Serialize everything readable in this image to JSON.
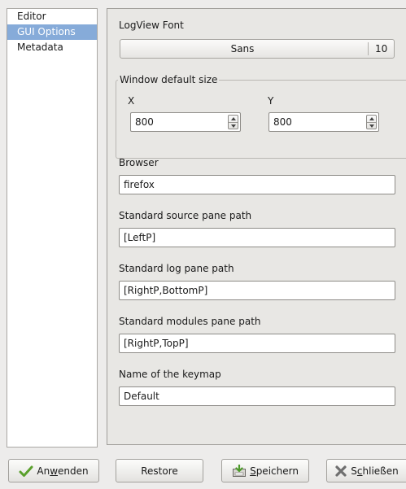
{
  "sidebar": {
    "items": [
      {
        "label": "Editor"
      },
      {
        "label": "GUI Options"
      },
      {
        "label": "Metadata"
      }
    ]
  },
  "gui_options": {
    "logview_font": {
      "label": "LogView Font",
      "font_name": "Sans",
      "font_size": "10"
    },
    "window_default_size": {
      "title": "Window default size",
      "x_label": "X",
      "x_value": "800",
      "y_label": "Y",
      "y_value": "800"
    },
    "browser": {
      "label": "Browser",
      "value": "firefox"
    },
    "source_pane_path": {
      "label": "Standard source pane path",
      "value": "[LeftP]"
    },
    "log_pane_path": {
      "label": "Standard log pane path",
      "value": "[RightP,BottomP]"
    },
    "modules_pane_path": {
      "label": "Standard modules pane path",
      "value": "[RightP,TopP]"
    },
    "keymap": {
      "label": "Name of the keymap",
      "value": "Default"
    }
  },
  "buttons": {
    "apply": {
      "pre": "An",
      "mnemonic": "w",
      "post": "enden",
      "icon": "checkmark-icon"
    },
    "restore": {
      "label": "Restore"
    },
    "save": {
      "mnemonic": "S",
      "post": "peichern",
      "icon": "save-icon"
    },
    "close": {
      "pre": "S",
      "mnemonic": "c",
      "post": "hließen",
      "icon": "close-x-icon"
    }
  },
  "colors": {
    "selection": "#86abd9",
    "window_bg": "#edeceb"
  }
}
